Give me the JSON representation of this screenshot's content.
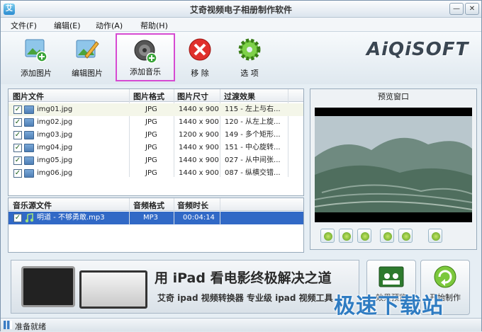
{
  "window": {
    "title": "艾奇视频电子相册制作软件",
    "min_label": "—",
    "close_label": "✕"
  },
  "menu": [
    "文件(F)",
    "编辑(E)",
    "动作(A)",
    "帮助(H)"
  ],
  "toolbar": {
    "add_image": "添加图片",
    "edit_image": "编辑图片",
    "add_music": "添加音乐",
    "remove": "移 除",
    "options": "选 项",
    "logo": "AiQiSOFT"
  },
  "image_table": {
    "headers": [
      "图片文件",
      "图片格式",
      "图片尺寸",
      "过渡效果"
    ],
    "rows": [
      {
        "file": "img01.jpg",
        "format": "JPG",
        "size": "1440 x 900",
        "effect": "115 - 左上与右..."
      },
      {
        "file": "img02.jpg",
        "format": "JPG",
        "size": "1440 x 900",
        "effect": "120 - 从左上旋..."
      },
      {
        "file": "img03.jpg",
        "format": "JPG",
        "size": "1200 x 900",
        "effect": "149 - 多个矩形..."
      },
      {
        "file": "img04.jpg",
        "format": "JPG",
        "size": "1440 x 900",
        "effect": "151 - 中心旋转..."
      },
      {
        "file": "img05.jpg",
        "format": "JPG",
        "size": "1440 x 900",
        "effect": "027 - 从中间张..."
      },
      {
        "file": "img06.jpg",
        "format": "JPG",
        "size": "1440 x 900",
        "effect": "087 - 纵横交错..."
      }
    ]
  },
  "music_table": {
    "headers": [
      "音乐源文件",
      "音频格式",
      "音频时长"
    ],
    "rows": [
      {
        "file": "明道 - 不够勇敢.mp3",
        "format": "MP3",
        "duration": "00:04:14"
      }
    ]
  },
  "preview": {
    "title": "预览窗口",
    "controls": [
      "rotate-right-icon",
      "rotate-left-icon",
      "refresh-icon",
      "flip-horizontal-icon",
      "flip-vertical-icon",
      "text-icon"
    ]
  },
  "banner": {
    "headline": "用 iPad 看电影终极解决之道",
    "subline": "艾奇 ipad 视频转换器  专业级 ipad 视频工具"
  },
  "actions": {
    "preview_label": "效果预览",
    "start_label": "开始制作"
  },
  "status": {
    "text": "准备就绪"
  },
  "watermark": "极速下载站"
}
